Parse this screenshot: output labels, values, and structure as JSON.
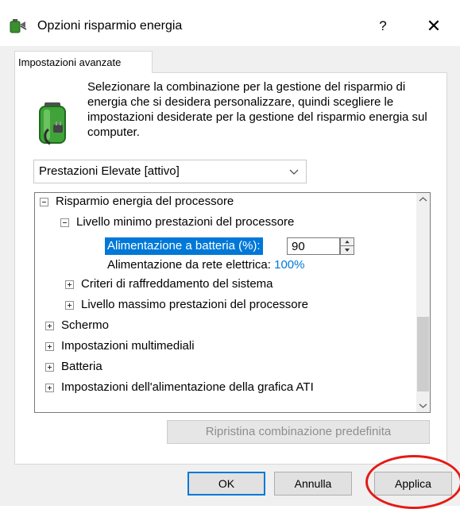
{
  "window": {
    "title": "Opzioni risparmio energia",
    "help": "?",
    "close": "✕"
  },
  "tab": {
    "label": "Impostazioni avanzate"
  },
  "description": "Selezionare la combinazione per la gestione del risparmio di energia che si desidera personalizzare, quindi scegliere le impostazioni desiderate per la gestione del risparmio energia sul computer.",
  "plan_select": {
    "value": "Prestazioni Elevate [attivo]"
  },
  "tree": {
    "processor": "Risparmio energia del processore",
    "min_state": "Livello minimo prestazioni del processore",
    "on_battery_label": "Alimentazione a batteria (%):",
    "on_battery_value": "90",
    "plugged_in_label": "Alimentazione da rete elettrica:",
    "plugged_in_value": "100%",
    "cooling": "Criteri di raffreddamento del sistema",
    "max_state": "Livello massimo prestazioni del processore",
    "display": "Schermo",
    "multimedia": "Impostazioni multimediali",
    "battery": "Batteria",
    "ati": "Impostazioni dell'alimentazione della grafica ATI"
  },
  "buttons": {
    "restore": "Ripristina combinazione predefinita",
    "ok": "OK",
    "cancel": "Annulla",
    "apply": "Applica"
  },
  "colors": {
    "accent": "#0078d7",
    "annotation_circle": "#e41b17"
  },
  "icons": {
    "app": "power-options-icon",
    "panel": "battery-plug-icon"
  }
}
